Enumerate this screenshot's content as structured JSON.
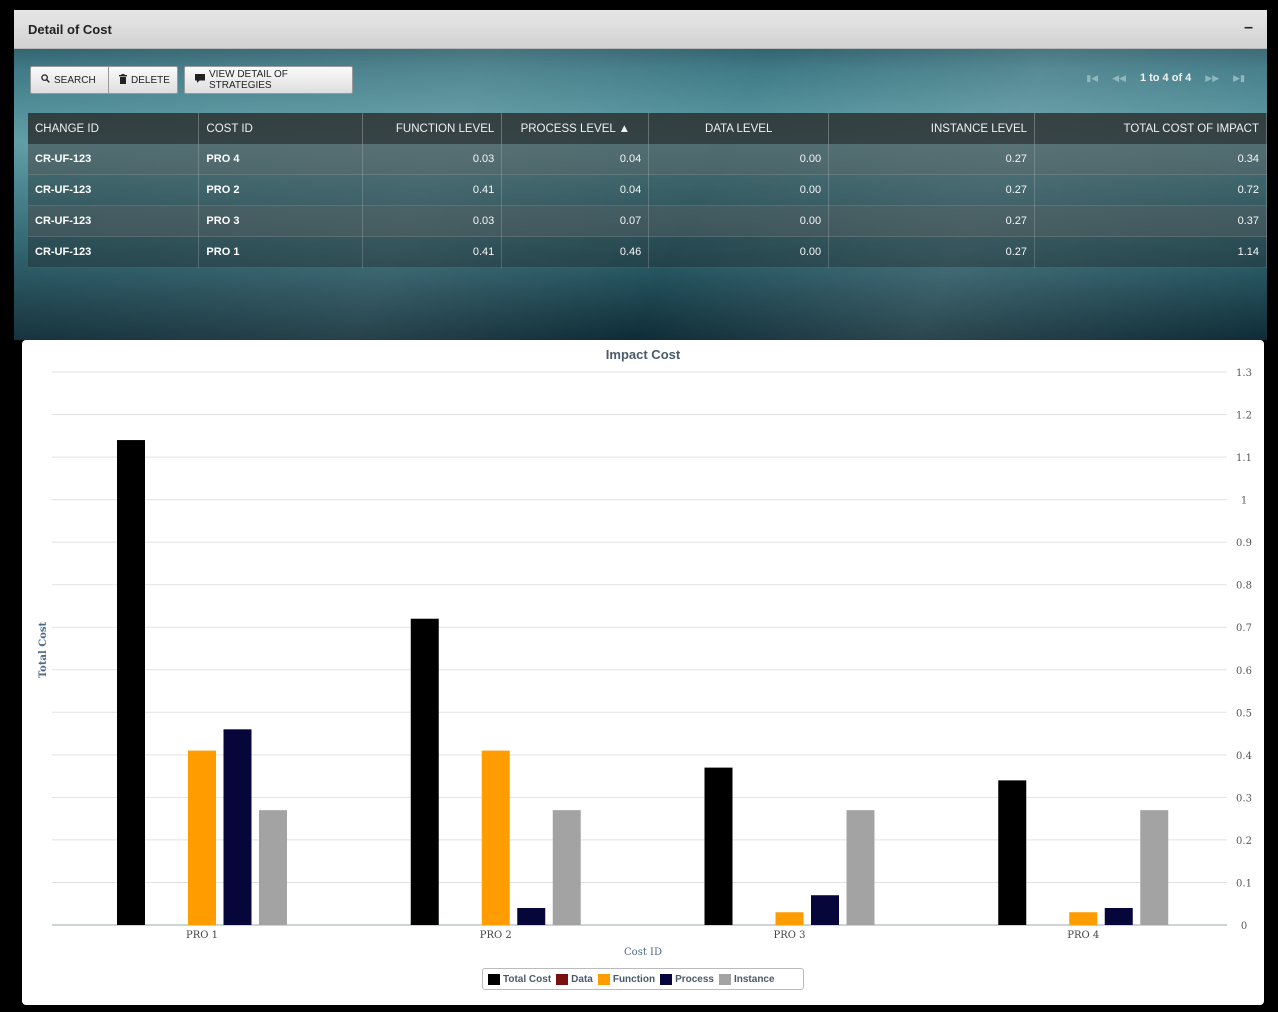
{
  "panel": {
    "title": "Detail of Cost",
    "collapse_label": "–"
  },
  "toolbar": {
    "search_label": "SEARCH",
    "delete_label": "DELETE",
    "view_label": "VIEW DETAIL OF STRATEGIES",
    "search_icon": "search-icon",
    "delete_icon": "trash-icon",
    "view_icon": "comment-icon"
  },
  "pager": {
    "text": "1 to 4 of 4"
  },
  "table": {
    "columns": [
      "CHANGE ID",
      "COST ID",
      "FUNCTION LEVEL",
      "PROCESS LEVEL ▲",
      "DATA LEVEL",
      "INSTANCE LEVEL",
      "TOTAL COST OF IMPACT"
    ],
    "rows": [
      [
        "CR-UF-123",
        "PRO 4",
        "0.03",
        "0.04",
        "0.00",
        "0.27",
        "0.34"
      ],
      [
        "CR-UF-123",
        "PRO 2",
        "0.41",
        "0.04",
        "0.00",
        "0.27",
        "0.72"
      ],
      [
        "CR-UF-123",
        "PRO 3",
        "0.03",
        "0.07",
        "0.00",
        "0.27",
        "0.37"
      ],
      [
        "CR-UF-123",
        "PRO 1",
        "0.41",
        "0.46",
        "0.00",
        "0.27",
        "1.14"
      ]
    ]
  },
  "chart_data": {
    "type": "bar",
    "title": "Impact Cost",
    "xlabel": "Cost ID",
    "ylabel": "Total Cost",
    "categories": [
      "PRO 1",
      "PRO 2",
      "PRO 3",
      "PRO 4"
    ],
    "ylim": [
      0,
      1.3
    ],
    "yticks": [
      "0",
      "0.1",
      "0.2",
      "0.3",
      "0.4",
      "0.5",
      "0.6",
      "0.7",
      "0.8",
      "0.9",
      "1",
      "1.1",
      "1.2",
      "1.3"
    ],
    "y_axis_side": "right",
    "grid": true,
    "legend_position": "bottom-center",
    "series": [
      {
        "name": "Total Cost",
        "color": "#000000",
        "values": [
          1.14,
          0.72,
          0.37,
          0.34
        ]
      },
      {
        "name": "Data",
        "color": "#7b1010",
        "values": [
          0.0,
          0.0,
          0.0,
          0.0
        ]
      },
      {
        "name": "Function",
        "color": "#ff9d00",
        "values": [
          0.41,
          0.41,
          0.03,
          0.03
        ]
      },
      {
        "name": "Process",
        "color": "#06063a",
        "values": [
          0.46,
          0.04,
          0.07,
          0.04
        ]
      },
      {
        "name": "Instance",
        "color": "#a3a3a3",
        "values": [
          0.27,
          0.27,
          0.27,
          0.27
        ]
      }
    ]
  }
}
